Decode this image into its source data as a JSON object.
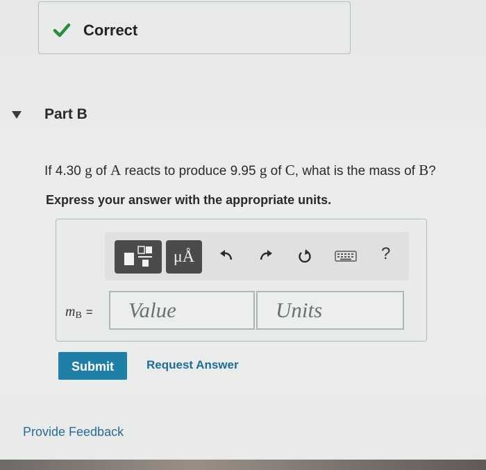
{
  "status": {
    "icon": "check-icon",
    "label": "Correct",
    "accent": "#2d8a3e"
  },
  "part": {
    "title": "Part B",
    "toggle_icon": "triangle-down-icon"
  },
  "question": {
    "t1": "If 4.30",
    "m1": "g",
    "t2": "of",
    "m2": "A",
    "t3": "reacts to produce 9.95",
    "m3": "g",
    "t4": "of",
    "m4": "C",
    "t5": ", what is the mass of",
    "m5": "B",
    "t6": "?"
  },
  "instruction": "Express your answer with the appropriate units.",
  "toolbar": {
    "symbols_label": "μÅ",
    "help_label": "?",
    "icons": [
      "templates-icon",
      "undo-icon",
      "redo-icon",
      "reset-icon",
      "keyboard-icon"
    ]
  },
  "answer": {
    "variable": "m",
    "subscript": "B",
    "equals": "=",
    "value_placeholder": "Value",
    "units_placeholder": "Units"
  },
  "actions": {
    "submit_label": "Submit",
    "request_label": "Request Answer",
    "feedback_label": "Provide Feedback",
    "submit_color": "#1f7fa6"
  }
}
